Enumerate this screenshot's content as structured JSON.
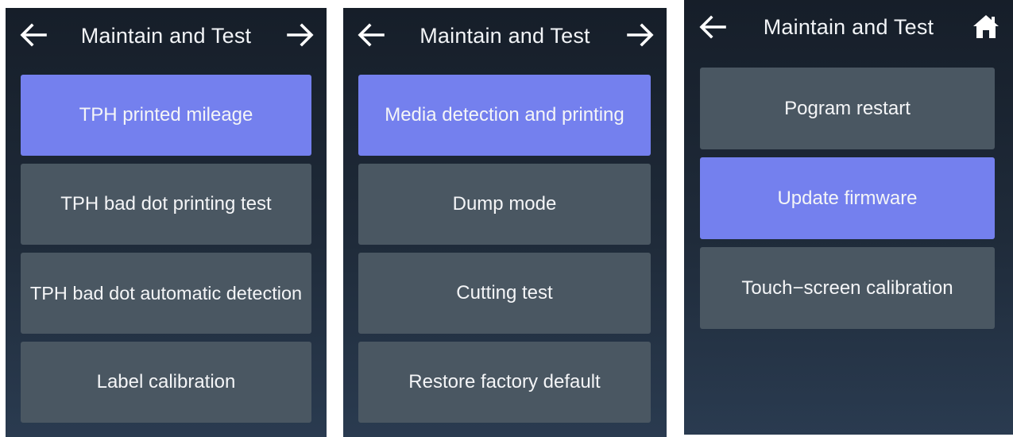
{
  "colors": {
    "background_top": "#161e29",
    "background_bottom": "#2a3b50",
    "item_default": "#4a5762",
    "item_selected": "#7480ee",
    "text": "#f4f5f7"
  },
  "screens": [
    {
      "title": "Maintain and Test",
      "left_icon": "arrow-left-icon",
      "right_icon": "arrow-right-icon",
      "items": [
        {
          "label": "TPH printed mileage",
          "selected": true
        },
        {
          "label": "TPH bad dot printing test",
          "selected": false
        },
        {
          "label": "TPH bad dot automatic detection",
          "selected": false
        },
        {
          "label": "Label calibration",
          "selected": false
        }
      ]
    },
    {
      "title": "Maintain and Test",
      "left_icon": "arrow-left-icon",
      "right_icon": "arrow-right-icon",
      "items": [
        {
          "label": "Media detection and printing",
          "selected": true
        },
        {
          "label": "Dump mode",
          "selected": false
        },
        {
          "label": "Cutting test",
          "selected": false
        },
        {
          "label": "Restore factory default",
          "selected": false
        }
      ]
    },
    {
      "title": "Maintain and Test",
      "left_icon": "arrow-left-icon",
      "right_icon": "home-icon",
      "items": [
        {
          "label": "Pogram restart",
          "selected": false
        },
        {
          "label": "Update firmware",
          "selected": true
        },
        {
          "label": "Touch−screen calibration",
          "selected": false
        }
      ]
    }
  ]
}
